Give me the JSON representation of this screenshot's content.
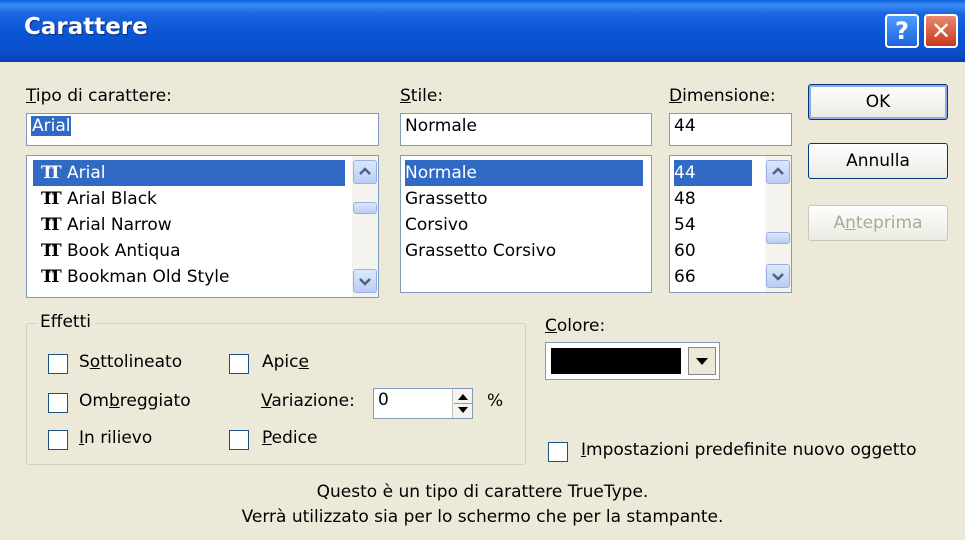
{
  "window": {
    "title": "Carattere",
    "help_glyph": "?",
    "close_glyph": "✕"
  },
  "font": {
    "label": "Tipo di carattere:",
    "value": "Arial",
    "items": [
      "Arial",
      "Arial Black",
      "Arial Narrow",
      "Book Antiqua",
      "Bookman Old Style"
    ],
    "selected": "Arial",
    "icon": "truetype-icon"
  },
  "style": {
    "label": "Stile:",
    "value": "Normale",
    "items": [
      "Normale",
      "Grassetto",
      "Corsivo",
      "Grassetto Corsivo"
    ],
    "selected": "Normale"
  },
  "size": {
    "label": "Dimensione:",
    "value": "44",
    "items": [
      "44",
      "48",
      "54",
      "60",
      "66"
    ],
    "selected": "44"
  },
  "buttons": {
    "ok": "OK",
    "cancel": "Annulla",
    "preview": "Anteprima"
  },
  "effects": {
    "legend": "Effetti",
    "underline": "Sottolineato",
    "superscript": "Apice",
    "shadow": "Ombreggiato",
    "offset_label": "Variazione:",
    "offset_value": "0",
    "offset_unit": "%",
    "emboss": "In rilievo",
    "subscript": "Pedice"
  },
  "color": {
    "label": "Colore:",
    "value_hex": "#000000"
  },
  "default_checkbox": "Impostazioni predefinite nuovo oggetto",
  "info": {
    "line1": "Questo è un tipo di carattere TrueType.",
    "line2": "Verrà utilizzato sia per lo schermo che per la stampante."
  }
}
